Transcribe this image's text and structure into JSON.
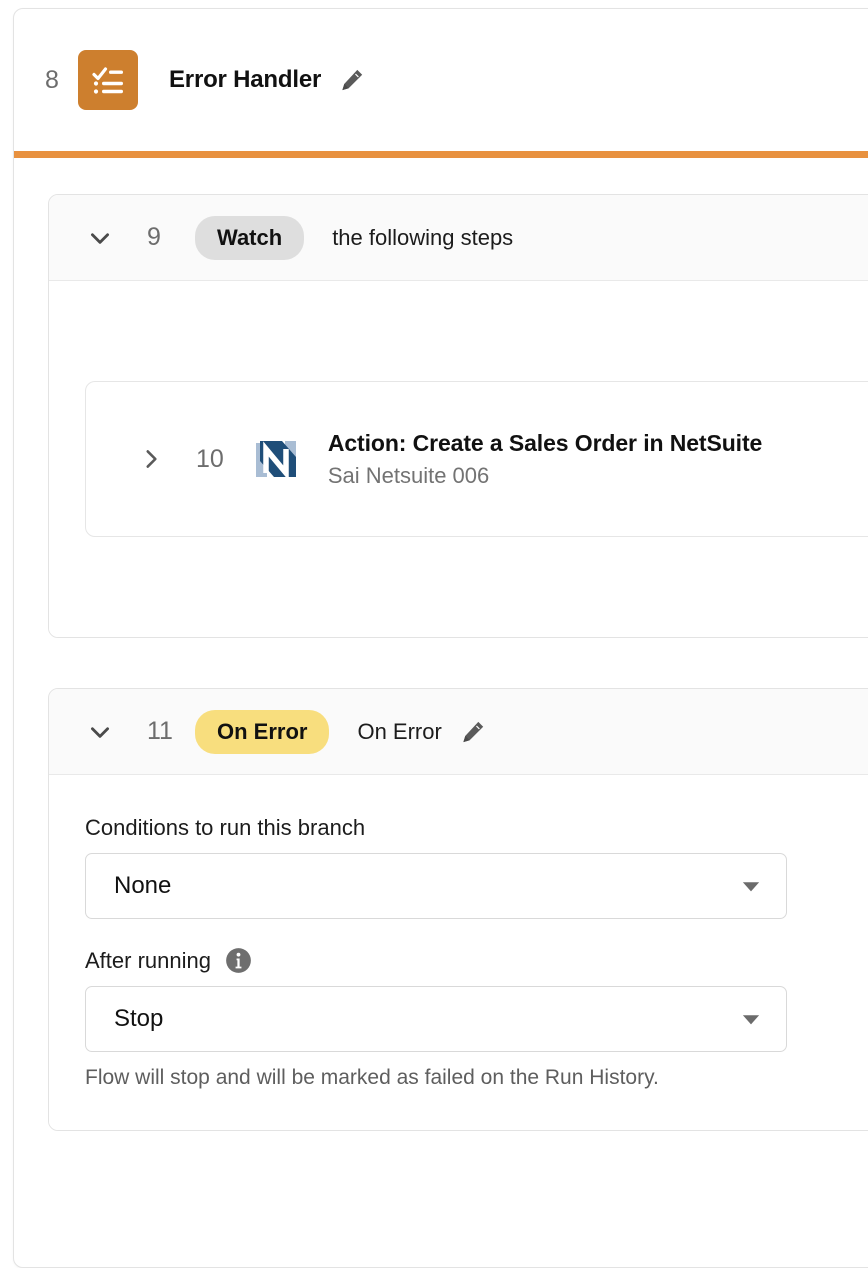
{
  "step": {
    "index": "8",
    "title": "Error Handler",
    "icon": "checklist-icon",
    "edit_icon": "pencil-icon",
    "accent_color": "#cd7f2e",
    "rule_color": "#e8913f"
  },
  "watch_branch": {
    "index": "9",
    "pill_label": "Watch",
    "pill_color": "#dedede",
    "description": "the following steps",
    "toggle_icon": "chevron-down-icon",
    "nested_step": {
      "index": "10",
      "toggle_icon": "chevron-right-icon",
      "app_icon": "netsuite-logo-icon",
      "title": "Action: Create a Sales Order in NetSuite",
      "connection": "Sai Netsuite 006"
    }
  },
  "on_error_branch": {
    "index": "11",
    "pill_label": "On Error",
    "pill_color": "#f8de7e",
    "name": "On Error",
    "toggle_icon": "chevron-down-icon",
    "edit_icon": "pencil-icon",
    "fields": {
      "conditions": {
        "label": "Conditions to run this branch",
        "value": "None",
        "caret_icon": "caret-down-icon"
      },
      "after_running": {
        "label": "After running",
        "info_icon": "info-icon",
        "value": "Stop",
        "caret_icon": "caret-down-icon",
        "helper": "Flow will stop and will be marked as failed on the Run History."
      }
    }
  }
}
